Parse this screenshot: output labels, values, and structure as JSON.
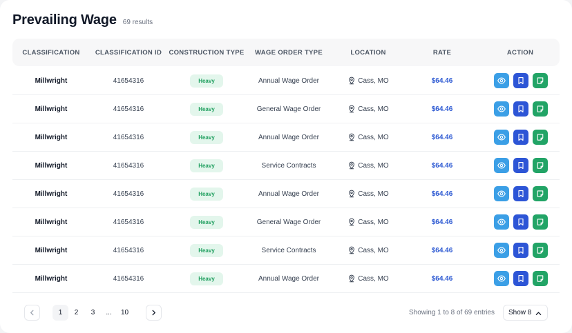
{
  "page": {
    "title": "Prevailing Wage",
    "result_count": "69 results"
  },
  "table": {
    "columns": [
      "CLASSIFICATION",
      "CLASSIFICATION ID",
      "CONSTRUCTION TYPE",
      "WAGE ORDER TYPE",
      "LOCATION",
      "RATE",
      "ACTION"
    ],
    "rows": [
      {
        "classification": "Millwright",
        "id": "41654316",
        "type": "Heavy",
        "wage_order": "Annual Wage Order",
        "location": "Cass, MO",
        "rate": "$64.46"
      },
      {
        "classification": "Millwright",
        "id": "41654316",
        "type": "Heavy",
        "wage_order": "General Wage Order",
        "location": "Cass, MO",
        "rate": "$64.46"
      },
      {
        "classification": "Millwright",
        "id": "41654316",
        "type": "Heavy",
        "wage_order": "Annual Wage Order",
        "location": "Cass, MO",
        "rate": "$64.46"
      },
      {
        "classification": "Millwright",
        "id": "41654316",
        "type": "Heavy",
        "wage_order": "Service Contracts",
        "location": "Cass, MO",
        "rate": "$64.46"
      },
      {
        "classification": "Millwright",
        "id": "41654316",
        "type": "Heavy",
        "wage_order": "Annual Wage Order",
        "location": "Cass, MO",
        "rate": "$64.46"
      },
      {
        "classification": "Millwright",
        "id": "41654316",
        "type": "Heavy",
        "wage_order": "General Wage Order",
        "location": "Cass, MO",
        "rate": "$64.46"
      },
      {
        "classification": "Millwright",
        "id": "41654316",
        "type": "Heavy",
        "wage_order": "Service Contracts",
        "location": "Cass, MO",
        "rate": "$64.46"
      },
      {
        "classification": "Millwright",
        "id": "41654316",
        "type": "Heavy",
        "wage_order": "Annual Wage Order",
        "location": "Cass, MO",
        "rate": "$64.46"
      }
    ],
    "action_icons": [
      "eye-icon",
      "bookmark-icon",
      "note-icon"
    ]
  },
  "pagination": {
    "pages": [
      "1",
      "2",
      "3",
      "...",
      "10"
    ],
    "current_page": "1",
    "entries_text": "Showing 1 to 8 of 69 entries",
    "page_size_label": "Show 8"
  },
  "colors": {
    "rate": "#2f5bd3",
    "badge_bg": "#e3f6ec",
    "badge_text": "#21a060",
    "view_button": "#3b9fe6",
    "save_button": "#2d55d6",
    "note_button": "#22a466"
  }
}
